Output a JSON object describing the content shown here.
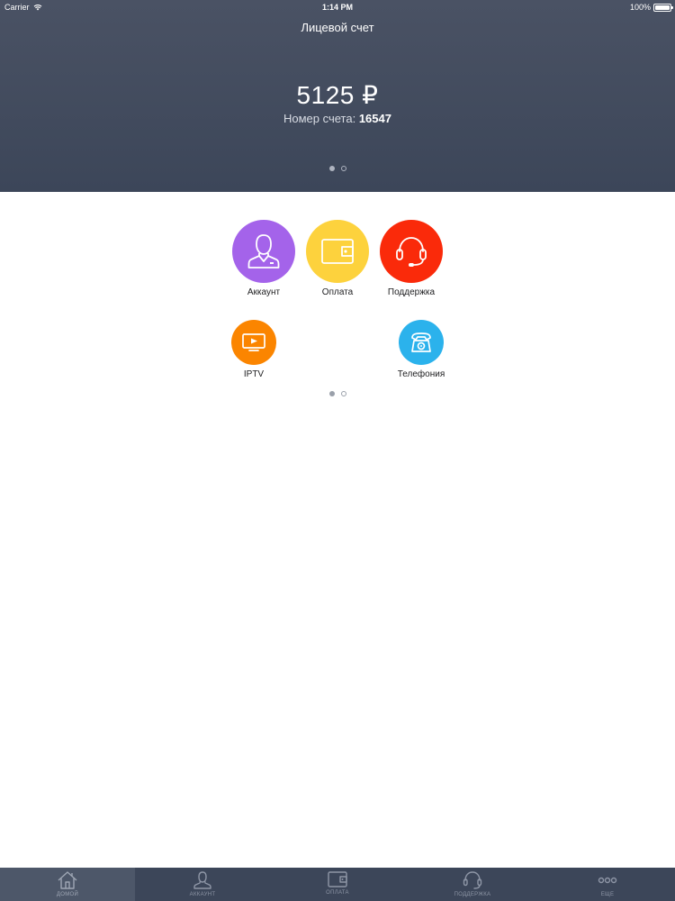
{
  "status_bar": {
    "carrier": "Carrier",
    "time": "1:14 PM",
    "battery_percent": "100%",
    "battery_level": 1.0
  },
  "header": {
    "title": "Лицевой счет",
    "balance": "5125 ₽",
    "account_label": "Номер счета:",
    "account_number": "16547",
    "page_dots": {
      "count": 2,
      "active_index": 0
    }
  },
  "services": {
    "items": [
      {
        "label": "Аккаунт",
        "icon": "user-icon",
        "color": "#a463ea"
      },
      {
        "label": "Оплата",
        "icon": "wallet-icon",
        "color": "#fdd23d"
      },
      {
        "label": "Поддержка",
        "icon": "headset-icon",
        "color": "#fa2a0a"
      },
      {
        "label": "IPTV",
        "icon": "tv-icon",
        "color": "#fb8500"
      },
      {
        "label": "Телефония",
        "icon": "phone-icon",
        "color": "#2bb2ec"
      }
    ],
    "page_dots": {
      "count": 2,
      "active_index": 0
    }
  },
  "tabbar": {
    "items": [
      {
        "label": "Домой",
        "icon": "home-icon",
        "active": true
      },
      {
        "label": "Аккаунт",
        "icon": "user-icon",
        "active": false
      },
      {
        "label": "Оплата",
        "icon": "wallet-icon",
        "active": false
      },
      {
        "label": "Поддержка",
        "icon": "headset-icon",
        "active": false
      },
      {
        "label": "Еще",
        "icon": "more-icon",
        "active": false
      }
    ]
  },
  "colors": {
    "header_bg": "#414b5e",
    "tabbar_bg": "#3c4659",
    "tabbar_active_bg": "#4d5769"
  }
}
